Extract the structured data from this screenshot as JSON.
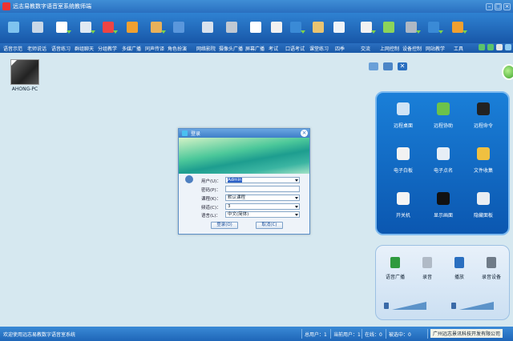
{
  "app": {
    "title": "远志易教数字语音室系统教师端"
  },
  "toolbar": {
    "icons": [
      {
        "name": "chat-bubble-icon",
        "color": "#7fc3ef"
      },
      {
        "name": "broadcast-icon",
        "color": "#c9d8e8"
      },
      {
        "name": "headset-icon",
        "color": "#ffffff"
      },
      {
        "name": "microphone-icon",
        "color": "#dfe9f3"
      },
      {
        "name": "notepad-icon",
        "color": "#e44"
      },
      {
        "name": "group-icon",
        "color": "#f0a030"
      },
      {
        "name": "monitor-person-icon",
        "color": "#e9b15a"
      },
      {
        "name": "download-icon",
        "color": "#5a97dc"
      },
      {
        "name": "tools-icon",
        "color": "#d9e3ee"
      },
      {
        "name": "camera-icon",
        "color": "#c0c9d3"
      },
      {
        "name": "screen-icon",
        "color": "#ffffff"
      },
      {
        "name": "exam-icon",
        "color": "#f1f1f1"
      },
      {
        "name": "oral-exam-icon",
        "color": "#3a8ad6"
      },
      {
        "name": "brush-icon",
        "color": "#e9c471"
      },
      {
        "name": "search-doc-icon",
        "color": "#f0f4f8"
      },
      {
        "name": "qq-icon",
        "color": "#f2f2f2"
      },
      {
        "name": "web-icon",
        "color": "#8cd45a"
      },
      {
        "name": "device-control-icon",
        "color": "#aeb8c4"
      },
      {
        "name": "earth-icon",
        "color": "#3a8ad6"
      },
      {
        "name": "safe-icon",
        "color": "#f0a030"
      }
    ]
  },
  "menu": {
    "items": [
      "语音示范",
      "老师说话",
      "语音练习",
      "群组聊天",
      "分组教学",
      "多媒广播",
      "同声传译",
      "角色扮演",
      "网络影院",
      "摄像头广播",
      "屏幕广播",
      "考试",
      "口语考试",
      "课堂练习",
      "四季",
      "交流",
      "上网控制",
      "设备控制",
      "网站教学",
      "工具"
    ]
  },
  "desktop": {
    "computer_label": "AHONG-PC"
  },
  "right_panel": {
    "function_items": [
      "远程桌面",
      "远程协助",
      "远程命令",
      "电子白板",
      "电子点名",
      "文件收集",
      "开关机",
      "显示画面",
      "隐藏面板"
    ],
    "audio_items": [
      "语音广播",
      "录音",
      "播放",
      "录音设备"
    ],
    "volume_levels": {
      "speaker": 0.85,
      "microphone": 0.85
    }
  },
  "dialog": {
    "title": "登录",
    "fields": [
      {
        "label": "用户(U)：",
        "value": "Admin",
        "type": "combo"
      },
      {
        "label": "密码(P)：",
        "value": "",
        "type": "password"
      },
      {
        "label": "课程(K)：",
        "value": "默认课程",
        "type": "combo"
      },
      {
        "label": "频道(C)：",
        "value": "3",
        "type": "combo"
      },
      {
        "label": "语言(L)：",
        "value": "中文(简体)",
        "type": "combo"
      }
    ],
    "ok_label": "登录(O)",
    "cancel_label": "取消(C)"
  },
  "status": {
    "message": "欢迎使用远志易教数字语音室系统",
    "total": "总用户：1",
    "current": "当前用户：1",
    "online": "在线：0",
    "selected": "被选中：0",
    "company": "广州远志景讯科技开发有限公司"
  },
  "colors": {
    "accent": "#2a6fc0",
    "panel_blue": "#0b57b0",
    "green": "#3aa12a"
  }
}
